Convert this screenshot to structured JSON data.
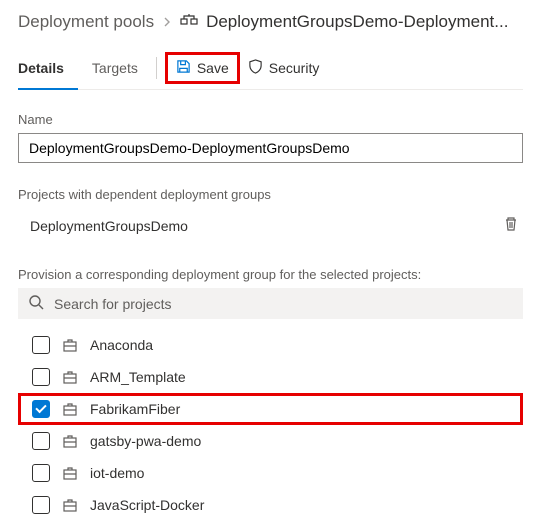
{
  "breadcrumb": {
    "root": "Deployment pools",
    "current": "DeploymentGroupsDemo-Deployment..."
  },
  "tabs": {
    "details": "Details",
    "targets": "Targets"
  },
  "toolbar": {
    "save": "Save",
    "security": "Security"
  },
  "name": {
    "label": "Name",
    "value": "DeploymentGroupsDemo-DeploymentGroupsDemo"
  },
  "dependent": {
    "label": "Projects with dependent deployment groups",
    "items": [
      "DeploymentGroupsDemo"
    ]
  },
  "provision": {
    "label": "Provision a corresponding deployment group for the selected projects:",
    "search_placeholder": "Search for projects",
    "projects": [
      {
        "name": "Anaconda",
        "checked": false
      },
      {
        "name": "ARM_Template",
        "checked": false
      },
      {
        "name": "FabrikamFiber",
        "checked": true
      },
      {
        "name": "gatsby-pwa-demo",
        "checked": false
      },
      {
        "name": "iot-demo",
        "checked": false
      },
      {
        "name": "JavaScript-Docker",
        "checked": false
      }
    ]
  }
}
